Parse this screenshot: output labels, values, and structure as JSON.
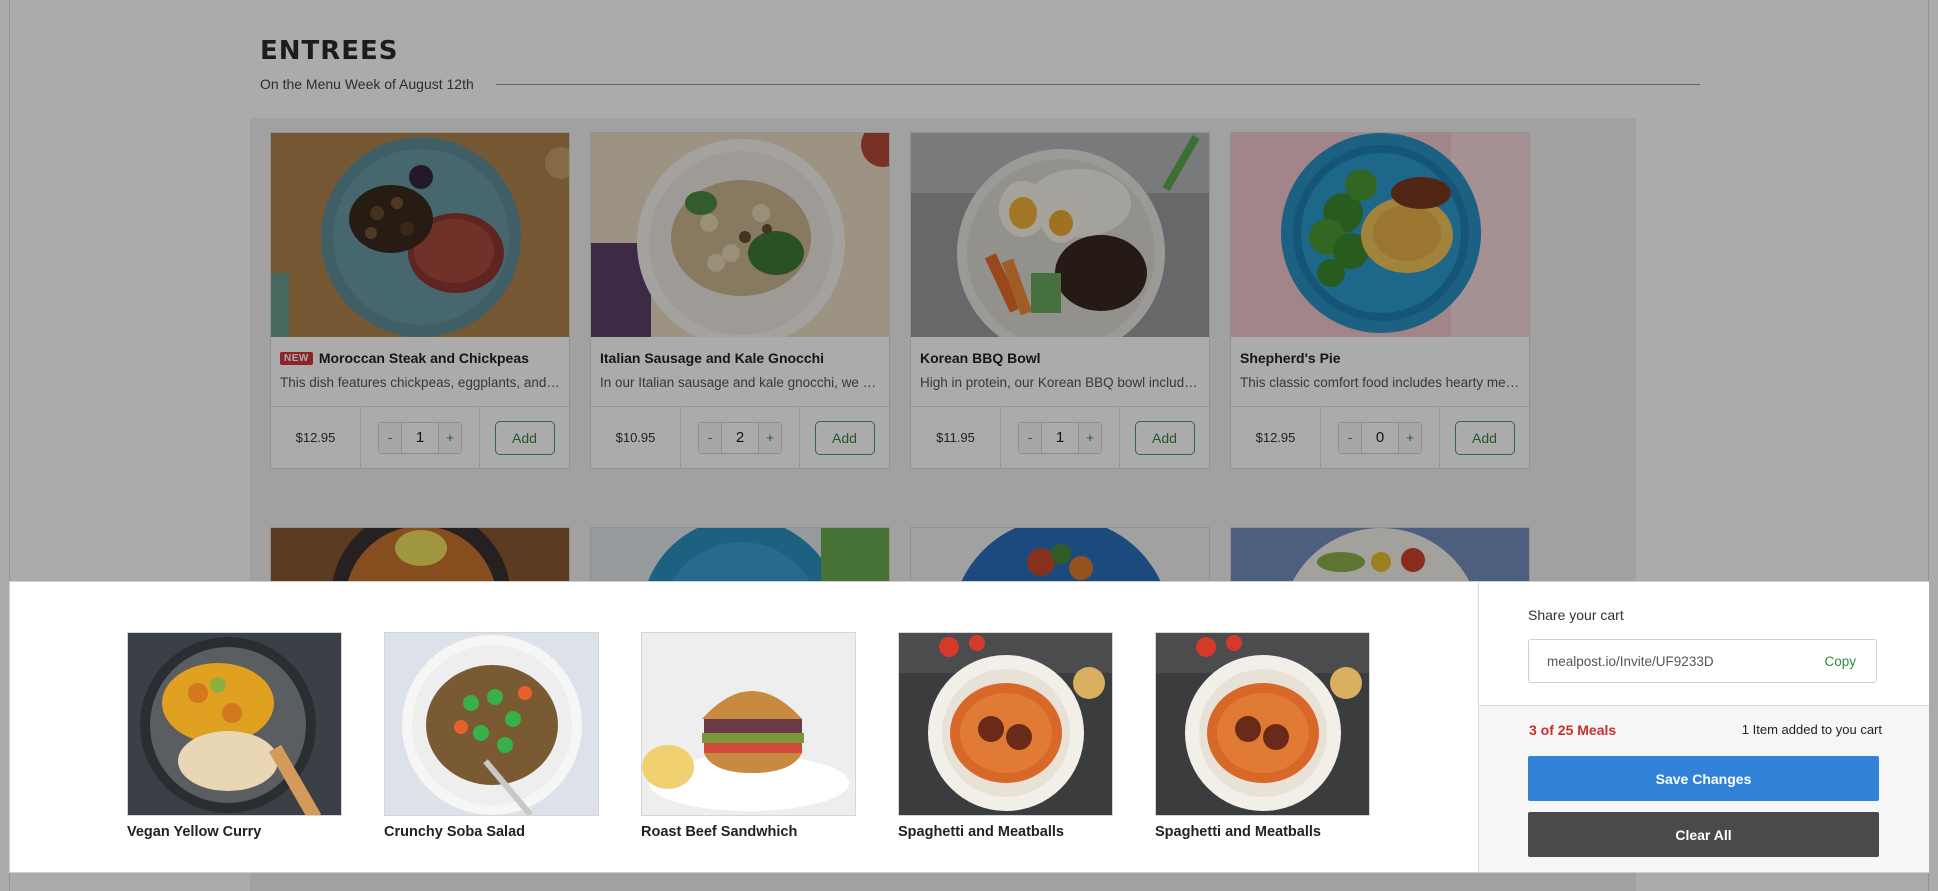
{
  "section": {
    "title": "ENTREES",
    "subtitle": "On the Menu Week of August 12th"
  },
  "menu_items": [
    {
      "badge": "NEW",
      "name": "Moroccan Steak and Chickpeas",
      "description": "This dish features chickpeas, eggplants, and …",
      "price": "$12.95",
      "quantity": "1",
      "add_label": "Add",
      "minus_label": "-",
      "plus_label": "+"
    },
    {
      "name": "Italian Sausage and Kale Gnocchi",
      "description": "In our Italian sausage and kale gnocchi, we us…",
      "price": "$10.95",
      "quantity": "2",
      "add_label": "Add",
      "minus_label": "-",
      "plus_label": "+"
    },
    {
      "name": "Korean BBQ Bowl",
      "description": "High in protein, our Korean BBQ bowl include…",
      "price": "$11.95",
      "quantity": "1",
      "add_label": "Add",
      "minus_label": "-",
      "plus_label": "+"
    },
    {
      "name": "Shepherd's Pie",
      "description": "This classic comfort food includes hearty me…",
      "price": "$12.95",
      "quantity": "0",
      "add_label": "Add",
      "minus_label": "-",
      "plus_label": "+"
    }
  ],
  "cart": {
    "items": [
      {
        "name": "Vegan Yellow Curry"
      },
      {
        "name": "Crunchy Soba Salad"
      },
      {
        "name": "Roast Beef Sandwhich"
      },
      {
        "name": "Spaghetti and Meatballs"
      },
      {
        "name": "Spaghetti and Meatballs"
      }
    ],
    "share_label": "Share your cart",
    "share_url": "mealpost.io/Invite/UF9233D",
    "copy_label": "Copy",
    "meals_count": "3 of 25 Meals",
    "added_note": "1 Item added to you cart",
    "save_label": "Save Changes",
    "clear_label": "Clear All"
  },
  "colors": {
    "accent_blue": "#3282d8",
    "accent_green": "#2e8b3e",
    "alert_red": "#c9302c",
    "badge_red": "#d6333b",
    "dark_button": "#4a4a4a"
  }
}
